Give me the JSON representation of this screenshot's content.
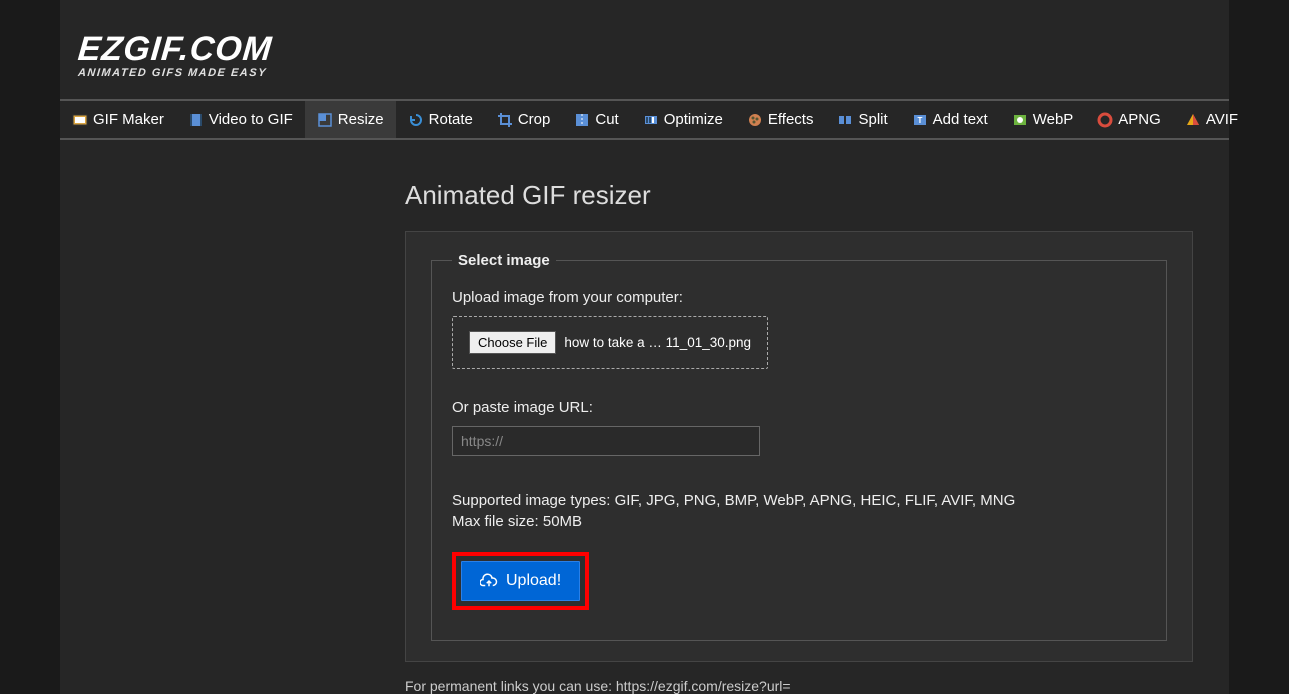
{
  "logo": {
    "title": "EZGIF.COM",
    "tagline": "ANIMATED GIFS MADE EASY"
  },
  "nav": [
    {
      "label": "GIF Maker",
      "icon": "gif-maker-icon",
      "color": "#d9a441"
    },
    {
      "label": "Video to GIF",
      "icon": "video-icon",
      "color": "#5a8fd6"
    },
    {
      "label": "Resize",
      "icon": "resize-icon",
      "color": "#5a8fd6",
      "active": true
    },
    {
      "label": "Rotate",
      "icon": "rotate-icon",
      "color": "#3a8fd6"
    },
    {
      "label": "Crop",
      "icon": "crop-icon",
      "color": "#5a8fd6"
    },
    {
      "label": "Cut",
      "icon": "cut-icon",
      "color": "#5a8fd6"
    },
    {
      "label": "Optimize",
      "icon": "optimize-icon",
      "color": "#5a8fd6"
    },
    {
      "label": "Effects",
      "icon": "effects-icon",
      "color": "#d08050"
    },
    {
      "label": "Split",
      "icon": "split-icon",
      "color": "#5a8fd6"
    },
    {
      "label": "Add text",
      "icon": "text-icon",
      "color": "#5a8fd6"
    },
    {
      "label": "WebP",
      "icon": "webp-icon",
      "color": "#6db33f"
    },
    {
      "label": "APNG",
      "icon": "apng-icon",
      "color": "#d94c3d"
    },
    {
      "label": "AVIF",
      "icon": "avif-icon",
      "color": "#e6a817"
    }
  ],
  "page": {
    "title": "Animated GIF resizer",
    "legend": "Select image",
    "uploadLabel": "Upload image from your computer:",
    "chooseFile": "Choose File",
    "fileName": "how to take a … 11_01_30.png",
    "urlLabel": "Or paste image URL:",
    "urlPlaceholder": "https://",
    "supported": "Supported image types: GIF, JPG, PNG, BMP, WebP, APNG, HEIC, FLIF, AVIF, MNG",
    "maxSize": "Max file size: 50MB",
    "uploadBtn": "Upload!",
    "footerPartial": "For permanent links you can use: https://ezgif.com/resize?url="
  }
}
